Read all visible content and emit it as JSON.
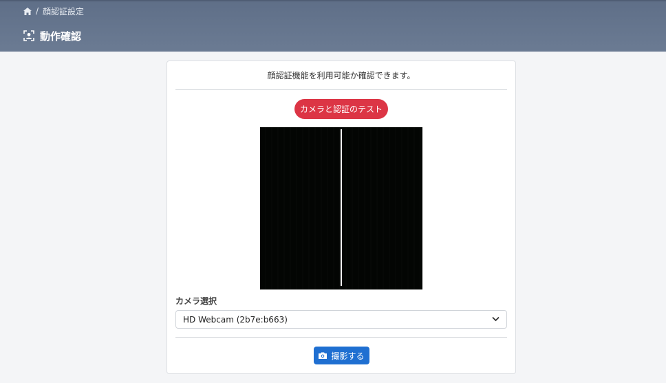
{
  "header": {
    "breadcrumb": {
      "current": "顔認証設定",
      "separator": "/"
    },
    "title": "動作確認",
    "home_icon": "home-icon",
    "title_icon": "face-scan-icon"
  },
  "card": {
    "description": "顔認証機能を利用可能か確認できます。",
    "test_button_label": "カメラと認証のテスト",
    "camera_label": "カメラ選択",
    "camera_select": {
      "selected": "HD Webcam (2b7e:b663)"
    },
    "capture_button_label": "撮影する",
    "capture_icon": "camera-icon"
  },
  "colors": {
    "header_bg": "#6b7b93",
    "test_button": "#dc3545",
    "capture_button": "#1f6fd1",
    "page_bg": "#f4f5f7"
  }
}
